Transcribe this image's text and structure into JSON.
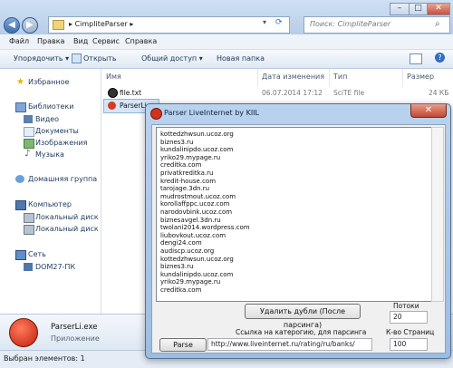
{
  "explorer": {
    "address": "CimpliteParser",
    "search_placeholder": "Поиск: CimpliteParser",
    "caption_buttons": [
      "–",
      "□",
      "✕"
    ],
    "menu": [
      "Файл",
      "Правка",
      "Вид",
      "Сервис",
      "Справка"
    ],
    "toolbar": [
      "Упорядочить ▾",
      "Открыть",
      "Общий доступ ▾",
      "Новая папка"
    ],
    "columns": [
      "Имя",
      "Дата изменения",
      "Тип",
      "Размер"
    ],
    "files": [
      {
        "name": "file.txt",
        "date": "06.07.2014 17:12",
        "type": "SciTE file",
        "size": "24 КБ"
      },
      {
        "name": "ParserLi",
        "date": "",
        "type": "",
        "size": ""
      }
    ],
    "nav": {
      "favorites": "Избранное",
      "libraries": "Библиотеки",
      "lib_items": [
        "Видео",
        "Документы",
        "Изображения",
        "Музыка"
      ],
      "homegroup": "Домашняя группа",
      "computer": "Компьютер",
      "drives": [
        "Локальный диск (C",
        "Локальный диск (D"
      ],
      "network": "Сеть",
      "network_items": [
        "DOM27-ПК"
      ]
    },
    "details": {
      "name": "ParserLi.exe",
      "type": "Приложение"
    },
    "status": "Выбран элементов: 1"
  },
  "dialog": {
    "title": "Parser LiveInternet by KIIL",
    "close": "✕",
    "lines": [
      "kottedzhwsun.ucoz.org",
      "biznes3.ru",
      "kundalinipdo.ucoz.com",
      "yriko29.mypage.ru",
      "creditka.com",
      "privatkreditka.ru",
      "kredit-house.com",
      "tarojage.3dn.ru",
      "mudrostmout.ucoz.com",
      "korollaffppc.ucoz.com",
      "narodovbink.ucoz.com",
      "biznesavgel.3dn.ru",
      "twolani2014.wordpress.com",
      "liubovkout.ucoz.com",
      "dengi24.com",
      "audiscp.ucoz.org",
      "kottedzhwsun.ucoz.org",
      "biznes3.ru",
      "kundalinipdo.ucoz.com",
      "yriko29.mypage.ru",
      "creditka.com"
    ],
    "dedupe_button": "Удалить дубли (После парсинга)",
    "threads_label": "Потоки",
    "threads_value": "20",
    "link_label": "Ссылка на катерогию, для парсинга",
    "pages_label": "К-во Страниц",
    "parse_button": "Parse",
    "url_value": "http://www.liveinternet.ru/rating/ru/banks/",
    "pages_value": "100"
  },
  "colors": {
    "accent": "#3d6fae",
    "dialog_frame": "#9cbde2",
    "close_red": "#c24a32"
  }
}
